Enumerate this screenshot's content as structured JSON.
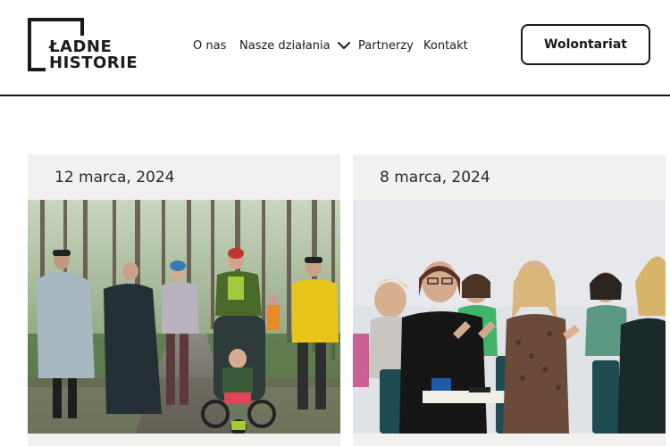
{
  "brand": {
    "line1": "ŁADNE",
    "line2": "HISTORIE"
  },
  "nav": {
    "items": [
      {
        "label": "O nas"
      },
      {
        "label": "Nasze działania"
      },
      {
        "label": "Partnerzy"
      },
      {
        "label": "Kontakt"
      }
    ],
    "cta_label": "Wolontariat"
  },
  "posts": [
    {
      "date": "12 marca, 2024",
      "image": "forest-walk-group-photo"
    },
    {
      "date": "8 marca, 2024",
      "image": "women-conference-applause-photo"
    }
  ],
  "colors": {
    "text": "#1a1a1a",
    "card_bg": "#f2f1ef",
    "accent_yellow": "#e8c619"
  }
}
